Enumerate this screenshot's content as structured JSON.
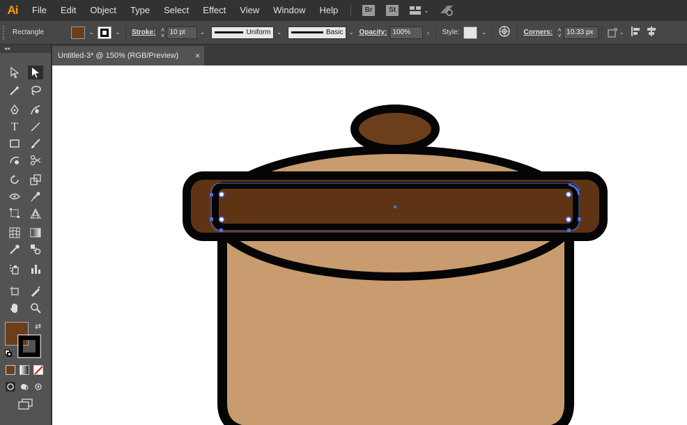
{
  "app": {
    "logo": "Ai"
  },
  "menu": [
    "File",
    "Edit",
    "Object",
    "Type",
    "Select",
    "Effect",
    "View",
    "Window",
    "Help"
  ],
  "app_icons": {
    "bridge": "Br",
    "stock": "St"
  },
  "control_bar": {
    "object_type": "Rectangle",
    "fill_color": "#6b3f1c",
    "stroke_label": "Stroke:",
    "stroke_weight": "10 pt",
    "stroke_profile": "Uniform",
    "brush": "Basic",
    "opacity_label": "Opacity:",
    "opacity": "100%",
    "style_label": "Style:",
    "corners_label": "Corners:",
    "corners": "10.33 px"
  },
  "document": {
    "tab_title": "Untitled-3* @ 150% (RGB/Preview)",
    "close_glyph": "×"
  },
  "toolbar": {
    "collapse_glyph": "◂◂",
    "fill_color": "#6b3f1c",
    "stroke_color": "#000000"
  },
  "artwork": {
    "pot_color": "#c89c6f",
    "handle_color": "#5f3415",
    "knob_color": "#6b3f1c",
    "outline_color": "#050505",
    "selection_color": "#4a6ee6"
  }
}
